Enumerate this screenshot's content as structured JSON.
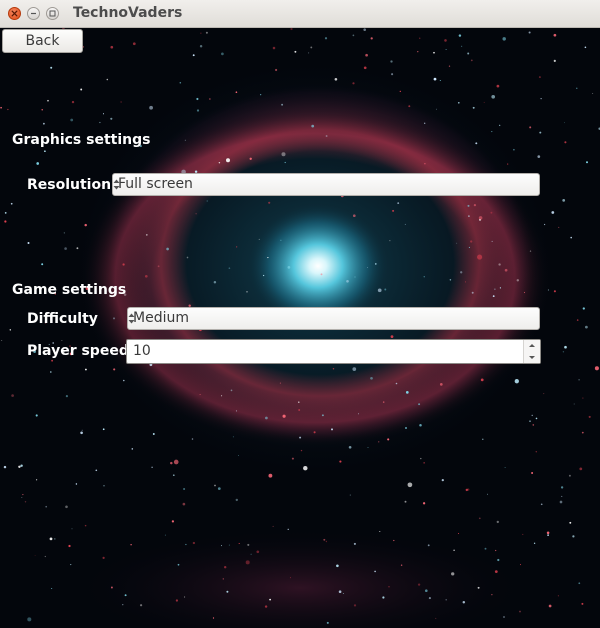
{
  "window": {
    "title": "TechnoVaders",
    "controls": [
      "close-icon",
      "minimize-icon",
      "maximize-icon"
    ]
  },
  "back_button": {
    "label": "Back"
  },
  "graphics": {
    "heading": "Graphics settings",
    "resolution_label": "Resolution",
    "resolution_value": "Full screen"
  },
  "game": {
    "heading": "Game settings",
    "difficulty_label": "Difficulty",
    "difficulty_value": "Medium",
    "player_speed_label": "Player speed",
    "player_speed_value": "10"
  },
  "colors": {
    "title_close": "#df4b16",
    "background_space": "#03060c",
    "galaxy_core": "#5fd3e6",
    "galaxy_ring": "#c4394c",
    "label_text": "#ffffff"
  }
}
